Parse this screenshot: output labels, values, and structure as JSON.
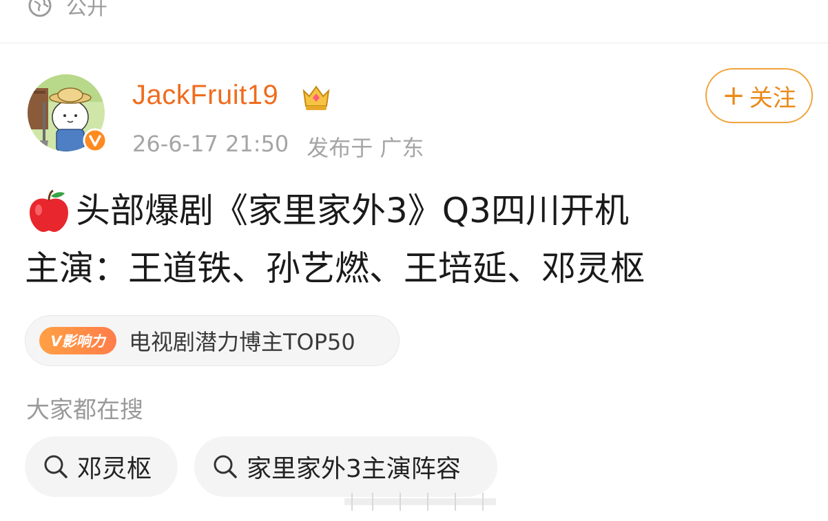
{
  "visibility": {
    "label": "公开",
    "icon": "globe-icon"
  },
  "post": {
    "author": {
      "username": "JackFruit19",
      "verified_icon": "v-verified-icon",
      "vip_icon": "crown-icon"
    },
    "meta": {
      "time": "26-6-17 21:50",
      "location": "发布于 广东"
    },
    "follow_button": {
      "plus": "+",
      "label": "关注"
    },
    "content": {
      "line1": "头部爆剧《家里家外3》Q3四川开机",
      "line2": "主演：王道铁、孙艺燃、王培延、邓灵枢",
      "emoji": "apple-icon"
    },
    "influence": {
      "badge": "V影响力",
      "text": "电视剧潜力博主TOP50"
    }
  },
  "search": {
    "label": "大家都在搜",
    "chips": [
      "邓灵枢",
      "家里家外3主演阵容"
    ]
  },
  "colors": {
    "accent": "#ef6c1e",
    "follow_border": "#f0a33a",
    "muted": "#a5a5a5"
  }
}
